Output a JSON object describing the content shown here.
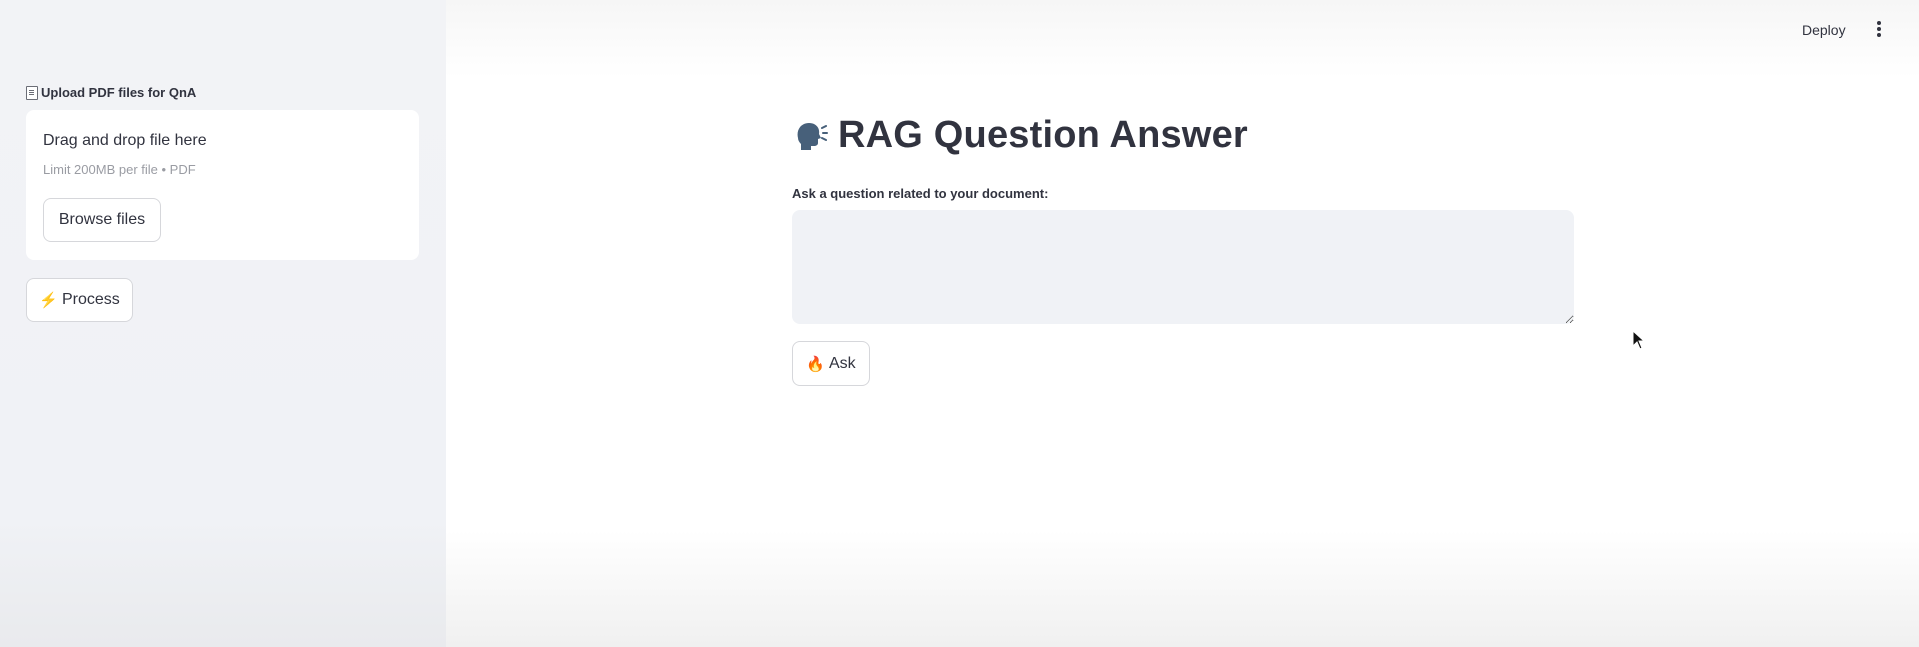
{
  "sidebar": {
    "upload_label": "Upload PDF files for QnA",
    "dropzone": {
      "title": "Drag and drop file here",
      "limit": "Limit 200MB per file • PDF",
      "browse_label": "Browse files"
    },
    "process_label": "Process"
  },
  "header": {
    "deploy_label": "Deploy"
  },
  "main": {
    "title": "RAG Question Answer",
    "question_label": "Ask a question related to your document:",
    "question_value": "",
    "ask_label": "Ask"
  },
  "icons": {
    "upload": "document-icon",
    "process": "lightning-icon",
    "title": "speaking-head-icon",
    "ask": "fire-icon",
    "menu": "kebab-menu-icon",
    "cursor": "mouse-cursor-icon"
  },
  "colors": {
    "sidebar_bg": "#f0f2f6",
    "text": "#31333f",
    "input_bg": "#f0f2f6",
    "button_border": "#d6d7db",
    "muted_text": "#9a9ca3"
  }
}
